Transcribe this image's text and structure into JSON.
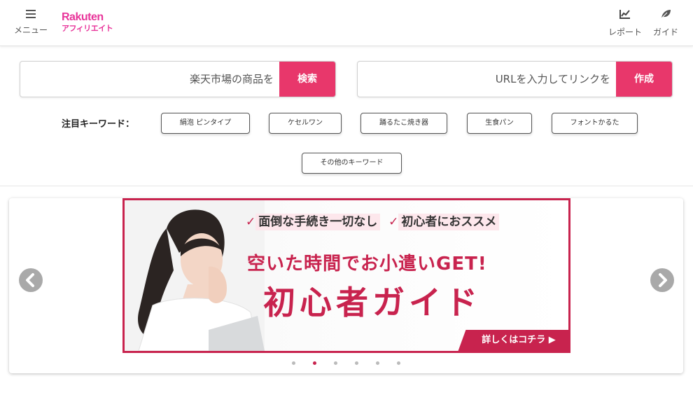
{
  "header": {
    "menu_label": "メニュー",
    "logo_line1": "Rakuten",
    "logo_line2": "アフィリエイト",
    "report_label": "レポート",
    "guide_label": "ガイド"
  },
  "search": {
    "market_placeholder": "楽天市場の商品を",
    "market_button": "検索",
    "url_placeholder": "URLを入力してリンクを",
    "url_button": "作成"
  },
  "keywords": {
    "label": "注目キーワード：",
    "items": [
      "絹泡 ピンタイプ",
      "ケセルワン",
      "踊るたこ焼き器",
      "生食パン",
      "フォントかるた"
    ],
    "more": "その他のキーワード"
  },
  "banner": {
    "line1a": "面倒な手続き一切なし",
    "line1b": "初心者におススメ",
    "line2": "空いた時間でお小遣いGET!",
    "line3": "初心者ガイド",
    "cta": "詳しくはコチラ ▶",
    "check": "✓"
  },
  "carousel": {
    "slide_count": 6,
    "active_index": 1
  },
  "colors": {
    "brand_pink": "#e8359a",
    "button_red": "#e8376b",
    "banner_red": "#c8234e"
  },
  "icons": [
    "menu-icon",
    "chart-icon",
    "leaf-icon",
    "chevron-left-icon",
    "chevron-right-icon"
  ]
}
